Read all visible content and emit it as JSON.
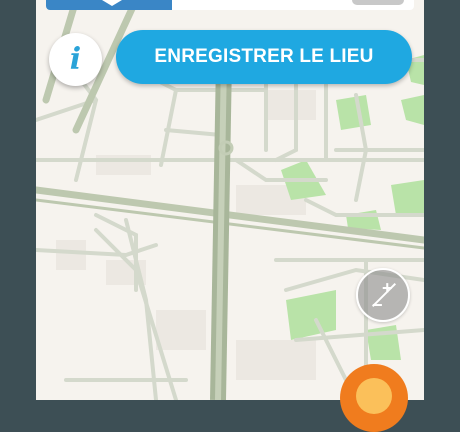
{
  "actions": {
    "save_place_label": "ENREGISTRER LE LIEU",
    "info_label": "i"
  },
  "map_controls": {
    "zoom_plus": "+",
    "zoom_minus": "−"
  },
  "colors": {
    "primary_blue": "#1fa8e1",
    "nav_blue": "#3a86c6",
    "frame": "#3d4f55",
    "map_bg": "#f6f3ee",
    "park_green": "#b9e3a8",
    "road": "#c3cdb6",
    "main_road": "#a8b69a",
    "location_orange": "#f07c1e"
  },
  "icons": {
    "info": "info-icon",
    "zoom": "zoom-icon",
    "location": "location-icon",
    "car": "car-icon",
    "direction": "direction-arrow-icon"
  }
}
